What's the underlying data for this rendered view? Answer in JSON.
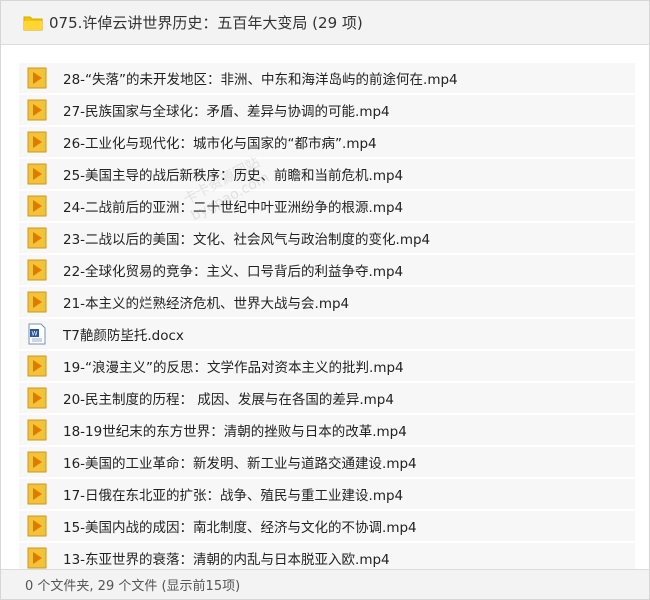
{
  "window": {
    "title": "075.许倬云讲世界历史：五百年大变局 (29 项)"
  },
  "files": [
    {
      "name": "28-“失落”的未开发地区：非洲、中东和海洋岛屿的前途何在.mp4",
      "icon": "video-file-icon"
    },
    {
      "name": "27-民族国家与全球化：矛盾、差异与协调的可能.mp4",
      "icon": "video-file-icon"
    },
    {
      "name": "26-工业化与现代化：城市化与国家的“都市病”.mp4",
      "icon": "video-file-icon"
    },
    {
      "name": "25-美国主导的战后新秩序：历史、前瞻和当前危机.mp4",
      "icon": "video-file-icon"
    },
    {
      "name": "24-二战前后的亚洲：二十世纪中叶亚洲纷争的根源.mp4",
      "icon": "video-file-icon"
    },
    {
      "name": "23-二战以后的美国：文化、社会风气与政治制度的变化.mp4",
      "icon": "video-file-icon"
    },
    {
      "name": "22-全球化贸易的竞争：主义、口号背后的利益争夺.mp4",
      "icon": "video-file-icon"
    },
    {
      "name": "21-本主义的烂熟经济危机、世界大战与会.mp4",
      "icon": "video-file-icon"
    },
    {
      "name": "T7靘颜防坒托.docx",
      "icon": "word-document-icon"
    },
    {
      "name": "19-“浪漫主义”的反思：文学作品对资本主义的批判.mp4",
      "icon": "video-file-icon"
    },
    {
      "name": "20-民主制度的历程： 成因、发展与在各国的差异.mp4",
      "icon": "video-file-icon"
    },
    {
      "name": "18-19世纪末的东方世界：清朝的挫败与日本的改革.mp4",
      "icon": "video-file-icon"
    },
    {
      "name": "16-美国的工业革命：新发明、新工业与道路交通建设.mp4",
      "icon": "video-file-icon"
    },
    {
      "name": "17-日俄在东北亚的扩张：战争、殖民与重工业建设.mp4",
      "icon": "video-file-icon"
    },
    {
      "name": "15-美国内战的成因：南北制度、经济与文化的不协调.mp4",
      "icon": "video-file-icon"
    },
    {
      "name": "13-东亚世界的衰落：清朝的内乱与日本脱亚入欧.mp4",
      "icon": "video-file-icon"
    }
  ],
  "status": {
    "text": "0 个文件夹, 29 个文件 (显示前15项)"
  },
  "watermark": {
    "line1": "卡卡资源网站",
    "line2": "bygpao.com"
  },
  "colors": {
    "title_bar": "#f3f3f3",
    "row_background": "#f7f7f7",
    "folder_yellow": "#f5c400",
    "video_icon_yellow": "#f2c23a",
    "play_triangle": "#e07a00",
    "word_blue": "#2b579a"
  }
}
